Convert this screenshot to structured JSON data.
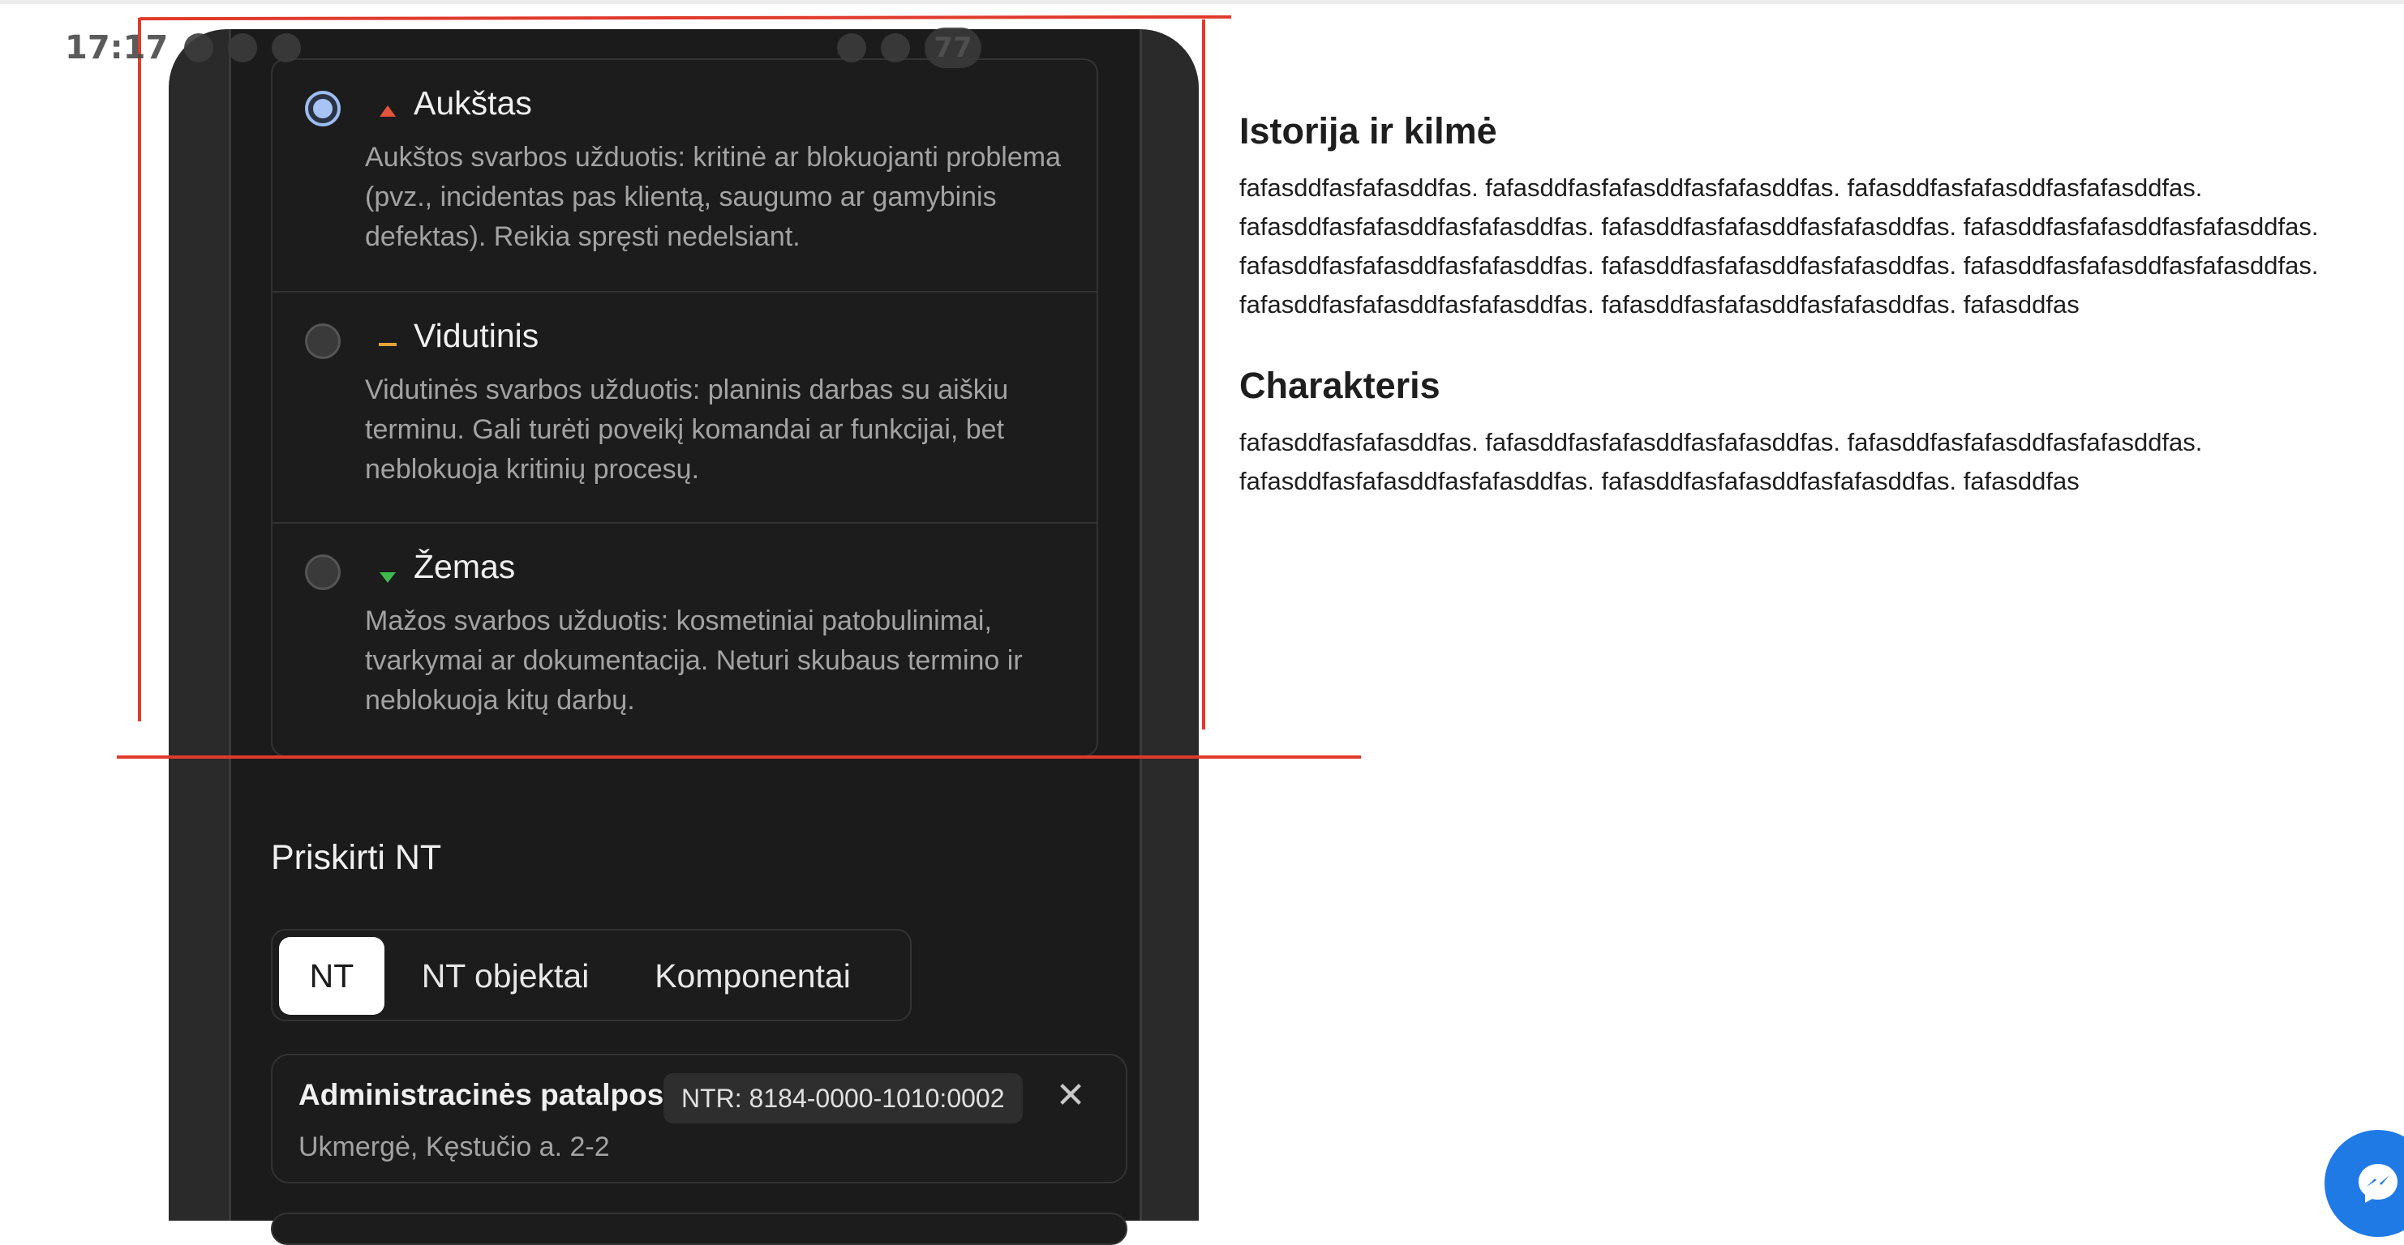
{
  "status_bar": {
    "time": "17:17",
    "battery": "77"
  },
  "priority": {
    "options": [
      {
        "label": "Aukštas",
        "description": "Aukštos svarbos užduotis: kritinė ar blokuojanti problema (pvz., incidentas pas klientą, saugumo ar gamybinis defektas). Reikia spręsti nedelsiant.",
        "icon": "arrow-up-icon",
        "color": "#e5533c",
        "selected": true
      },
      {
        "label": "Vidutinis",
        "description": "Vidutinės svarbos užduotis: planinis darbas su aiškiu terminu. Gali turėti poveikį komandai ar funkcijai, bet neblokuoja kritinių procesų.",
        "icon": "dash-icon",
        "color": "#e8a33a",
        "selected": false
      },
      {
        "label": "Žemas",
        "description": "Mažos svarbos užduotis: kosmetiniai patobulinimai, tvarkymai ar dokumentacija. Neturi skubaus termino ir neblokuoja kitų darbų.",
        "icon": "arrow-down-icon",
        "color": "#3fb950",
        "selected": false
      }
    ]
  },
  "assign": {
    "title": "Priskirti NT",
    "tabs": [
      "NT",
      "NT objektai",
      "Komponentai"
    ],
    "active_tab": "NT",
    "asset": {
      "name": "Administracinės patalpos",
      "badge": "NTR: 8184-0000-1010:0002",
      "address": "Ukmergė, Kęstučio a. 2-2"
    }
  },
  "article": {
    "sections": [
      {
        "title": "Istorija ir kilmė",
        "body": "fafasddfasfafasddfas. fafasddfasfafasddfasfafasddfas. fafasddfasfafasddfasfafasddfas. fafasddfasfafasddfasfafasddfas. fafasddfasfafasddfasfafasddfas. fafasddfasfafasddfasfafasddfas. fafasddfasfafasddfasfafasddfas. fafasddfasfafasddfasfafasddfas. fafasddfasfafasddfasfafasddfas. fafasddfasfafasddfasfafasddfas. fafasddfasfafasddfasfafasddfas. fafasddfas"
      },
      {
        "title": "Charakteris",
        "body": "fafasddfasfafasddfas. fafasddfasfafasddfasfafasddfas. fafasddfasfafasddfasfafasddfas. fafasddfasfafasddfasfafasddfas. fafasddfasfafasddfasfafasddfas. fafasddfas"
      }
    ]
  },
  "colors": {
    "annotation_red": "#e03a2c",
    "messenger_blue": "#1f7ae6",
    "phone_bg": "#1b1b1b"
  }
}
